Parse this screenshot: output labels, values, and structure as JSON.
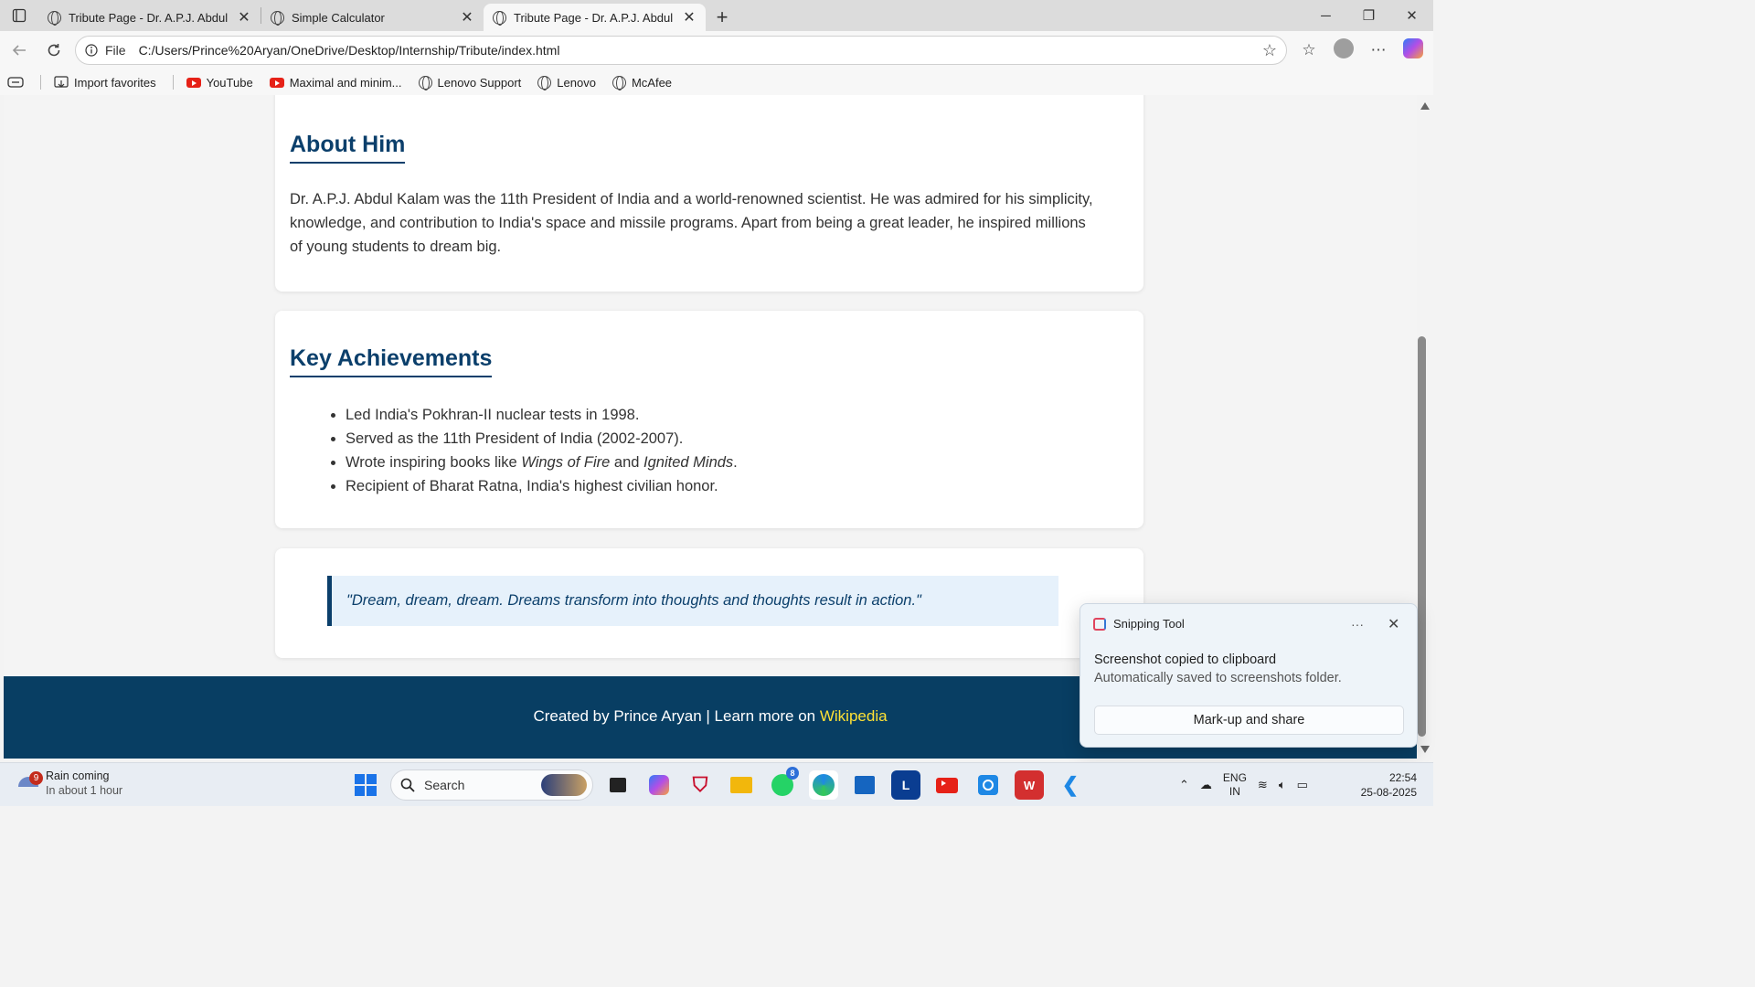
{
  "browser": {
    "tabs": [
      {
        "title": "Tribute Page - Dr. A.P.J. Abdul Kal",
        "active": false
      },
      {
        "title": "Simple Calculator",
        "active": false
      },
      {
        "title": "Tribute Page - Dr. A.P.J. Abdul Kal",
        "active": true
      }
    ],
    "address": {
      "scheme_label": "File",
      "url": "C:/Users/Prince%20Aryan/OneDrive/Desktop/Internship/Tribute/index.html"
    },
    "bookmarks": [
      {
        "label": "Import favorites",
        "icon": "import-icon"
      },
      {
        "label": "YouTube",
        "icon": "youtube-icon"
      },
      {
        "label": "Maximal and minim...",
        "icon": "youtube-icon"
      },
      {
        "label": "Lenovo Support",
        "icon": "globe-icon"
      },
      {
        "label": "Lenovo",
        "icon": "globe-icon"
      },
      {
        "label": "McAfee",
        "icon": "globe-icon"
      }
    ]
  },
  "page": {
    "about": {
      "heading": "About Him",
      "body": "Dr. A.P.J. Abdul Kalam was the 11th President of India and a world-renowned scientist. He was admired for his simplicity, knowledge, and contribution to India's space and missile programs. Apart from being a great leader, he inspired millions of young students to dream big."
    },
    "achievements": {
      "heading": "Key Achievements",
      "items": {
        "one": "Led India's Pokhran-II nuclear tests in 1998.",
        "two": "Served as the 11th President of India (2002-2007).",
        "three_prefix": "Wrote inspiring books like ",
        "three_book1": "Wings of Fire",
        "three_mid": " and ",
        "three_book2": "Ignited Minds",
        "three_suffix": ".",
        "four": "Recipient of Bharat Ratna, India's highest civilian honor."
      }
    },
    "quote": "\"Dream, dream, dream. Dreams transform into thoughts and thoughts result in action.\"",
    "footer": {
      "text": "Created by Prince Aryan | Learn more on ",
      "link": "Wikipedia"
    },
    "colors": {
      "primary": "#0b3f6b",
      "footer_bg": "#083e63",
      "link": "#ffe135"
    }
  },
  "toast": {
    "app": "Snipping Tool",
    "more": "···",
    "message": "Screenshot copied to clipboard",
    "sub": "Automatically saved to screenshots folder.",
    "button": "Mark-up and share"
  },
  "taskbar": {
    "weather_badge": "9",
    "weather_title": "Rain coming",
    "weather_sub": "In about 1 hour",
    "search_placeholder": "Search",
    "whatsapp_badge": "8",
    "lang_top": "ENG",
    "lang_bottom": "IN",
    "time": "22:54",
    "date": "25-08-2025"
  }
}
